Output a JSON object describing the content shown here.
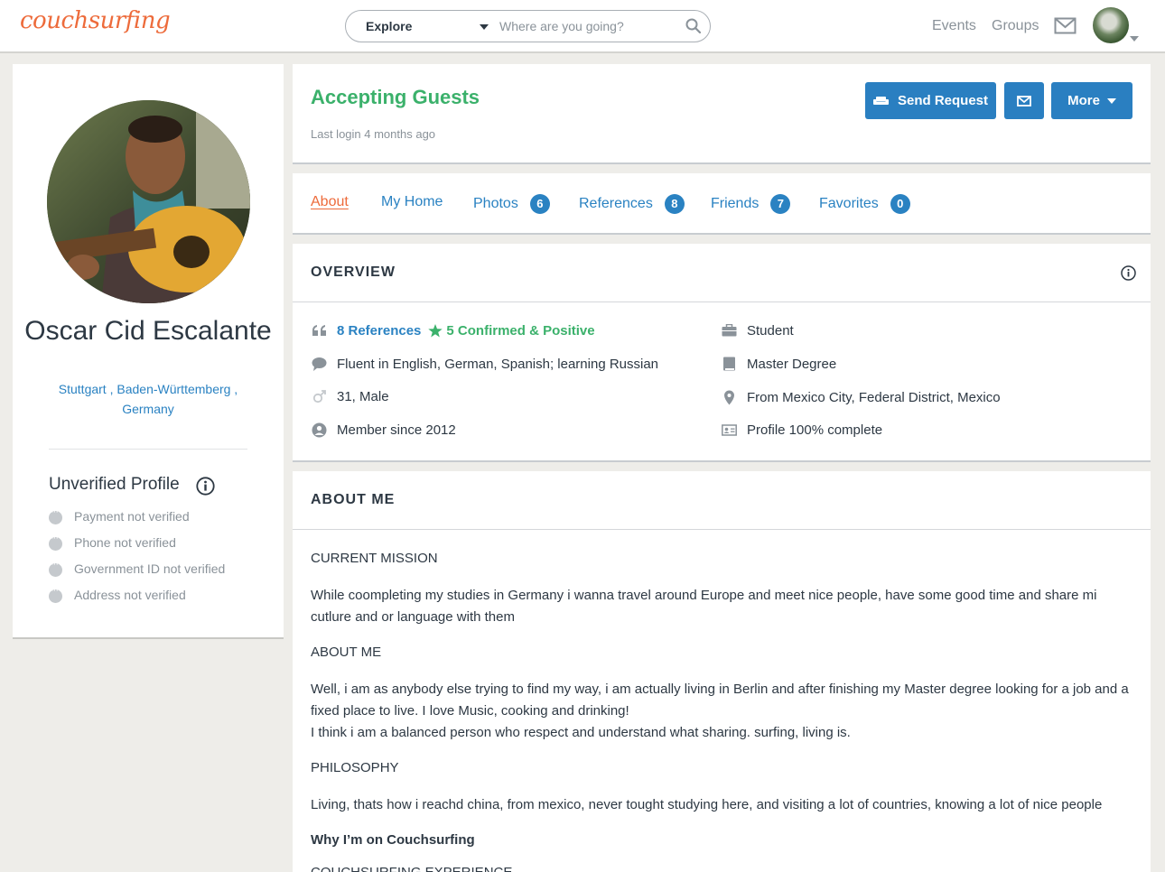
{
  "header": {
    "logo": "couchsurfing",
    "search_mode": "Explore",
    "search_placeholder": "Where are you going?",
    "nav_events": "Events",
    "nav_groups": "Groups"
  },
  "profile": {
    "name": "Oscar Cid Escalante",
    "location": "Stuttgart , Baden-Württemberg , Germany",
    "unverified_title": "Unverified Profile",
    "verifications": [
      "Payment not verified",
      "Phone not verified",
      "Government ID not verified",
      "Address not verified"
    ]
  },
  "status": {
    "accepting": "Accepting Guests",
    "last_login": "Last login 4 months ago",
    "send_request": "Send Request",
    "more": "More"
  },
  "tabs": [
    {
      "label": "About",
      "count": null
    },
    {
      "label": "My Home",
      "count": null
    },
    {
      "label": "Photos",
      "count": "6"
    },
    {
      "label": "References",
      "count": "8"
    },
    {
      "label": "Friends",
      "count": "7"
    },
    {
      "label": "Favorites",
      "count": "0"
    }
  ],
  "overview": {
    "title": "OVERVIEW",
    "references_link": "8 References",
    "confirmed": "5 Confirmed & Positive",
    "languages": "Fluent in English, German, Spanish; learning Russian",
    "age_gender": "31, Male",
    "member_since": "Member since 2012",
    "occupation": "Student",
    "education": "Master Degree",
    "hometown": "From Mexico City, Federal District, Mexico",
    "profile_complete": "Profile 100% complete"
  },
  "about": {
    "title": "ABOUT ME",
    "current_mission_head": "CURRENT MISSION",
    "current_mission": "While coompleting my studies in Germany i wanna travel around Europe and meet nice people, have some good time and share mi cutlure and or language with them",
    "about_me_head": "ABOUT ME",
    "about_me_1": "Well, i am as anybody else trying to find my way, i am actually living in Berlin and after finishing my Master degree looking for a job and a fixed place to live. I love Music, cooking and drinking!",
    "about_me_2": "I think i am a balanced person who respect and understand what sharing. surfing, living is.",
    "philosophy_head": "PHILOSOPHY",
    "philosophy": "Living, thats how i reachd china, from mexico, never tought studying here, and visiting a lot of countries, knowing a lot of nice people",
    "why_head": "Why I’m on Couchsurfing",
    "experience_head": "COUCHSURFING EXPERIENCE"
  },
  "colors": {
    "brand_orange": "#ed6b3b",
    "link_blue": "#2a82c2",
    "button_blue": "#2a7fc1",
    "accept_green": "#3bb16b"
  }
}
